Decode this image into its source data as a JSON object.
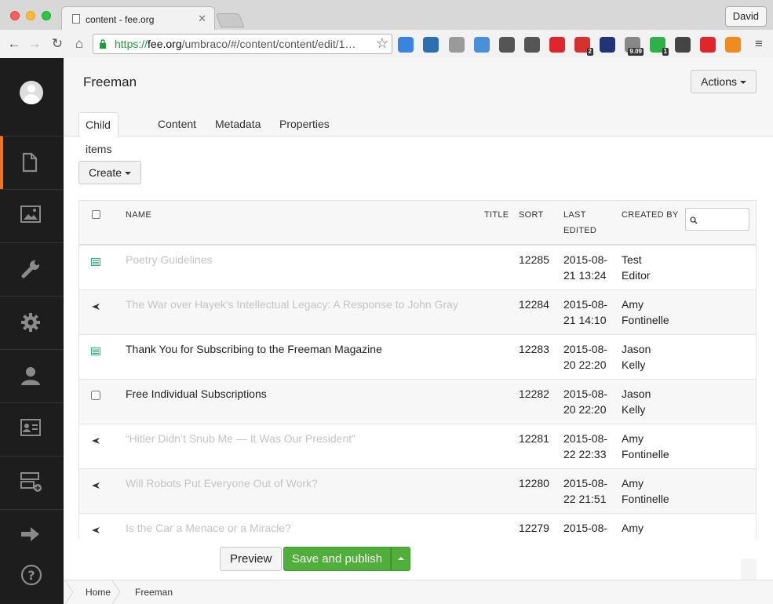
{
  "browser": {
    "tab_title": "content - fee.org",
    "profile_name": "David",
    "url_scheme": "https://",
    "url_host": "fee.org",
    "url_rest": "/umbraco/#/content/content/edit/1…",
    "extensions": [
      {
        "icon": "translate-icon",
        "color": "#3b82e5",
        "badge": ""
      },
      {
        "icon": "network-icon",
        "color": "#2c6fb2",
        "badge": ""
      },
      {
        "icon": "circle-icon",
        "color": "#9a9a9a",
        "badge": ""
      },
      {
        "icon": "folder-icon",
        "color": "#4a90d9",
        "badge": ""
      },
      {
        "icon": "plug-icon",
        "color": "#555555",
        "badge": ""
      },
      {
        "icon": "evernote-icon",
        "color": "#555555",
        "badge": ""
      },
      {
        "icon": "adblock-icon",
        "color": "#e0262c",
        "badge": ""
      },
      {
        "icon": "snowflake-icon",
        "color": "#d8302e",
        "badge": "2"
      },
      {
        "icon": "flag-icon",
        "color": "#23337a",
        "badge": ""
      },
      {
        "icon": "speed-icon",
        "color": "#888888",
        "badge": "9.09"
      },
      {
        "icon": "d-icon",
        "color": "#2db14b",
        "badge": "1"
      },
      {
        "icon": "gear-icon",
        "color": "#444444",
        "badge": ""
      },
      {
        "icon": "plus-cross-icon",
        "color": "#e0262c",
        "badge": ""
      },
      {
        "icon": "u-icon",
        "color": "#f28b1f",
        "badge": ""
      }
    ]
  },
  "header": {
    "title": "Freeman",
    "actions_label": "Actions",
    "tabs": [
      {
        "label": "Child items",
        "active": true
      },
      {
        "label": "Content",
        "active": false
      },
      {
        "label": "Metadata",
        "active": false
      },
      {
        "label": "Properties",
        "active": false
      }
    ]
  },
  "create_label": "Create",
  "table": {
    "columns": {
      "name": "NAME",
      "title": "TITLE",
      "sort": "SORT",
      "last_edited_1": "LAST",
      "last_edited_2": "EDITED",
      "created_by": "CREATED BY"
    },
    "rows": [
      {
        "icon": "newspaper-icon",
        "name": "Poetry Guidelines",
        "published": false,
        "sort": "12285",
        "edited_1": "2015-08-",
        "edited_2": "21 13:24",
        "by_1": "Test",
        "by_2": "Editor"
      },
      {
        "icon": "plane-icon",
        "name": "The War over Hayek's Intellectual Legacy: A Response to John Gray",
        "published": false,
        "sort": "12284",
        "edited_1": "2015-08-",
        "edited_2": "21 14:10",
        "by_1": "Amy",
        "by_2": "Fontinelle"
      },
      {
        "icon": "newspaper-icon",
        "name": "Thank You for Subscribing to the Freeman Magazine",
        "published": true,
        "sort": "12283",
        "edited_1": "2015-08-",
        "edited_2": "20 22:20",
        "by_1": "Jason",
        "by_2": "Kelly"
      },
      {
        "icon": "checkbox-icon",
        "name": "Free Individual Subscriptions",
        "published": true,
        "sort": "12282",
        "edited_1": "2015-08-",
        "edited_2": "20 22:20",
        "by_1": "Jason",
        "by_2": "Kelly"
      },
      {
        "icon": "plane-icon",
        "name": "“Hitler Didn’t Snub Me — It Was Our President”",
        "published": false,
        "sort": "12281",
        "edited_1": "2015-08-",
        "edited_2": "22 22:33",
        "by_1": "Amy",
        "by_2": "Fontinelle"
      },
      {
        "icon": "plane-icon",
        "name": "Will Robots Put Everyone Out of Work?",
        "published": false,
        "sort": "12280",
        "edited_1": "2015-08-",
        "edited_2": "22 21:51",
        "by_1": "Amy",
        "by_2": "Fontinelle"
      },
      {
        "icon": "plane-icon",
        "name": "Is the Car a Menace or a Miracle?",
        "published": false,
        "sort": "12279",
        "edited_1": "2015-08-",
        "edited_2": "",
        "by_1": "Amy",
        "by_2": ""
      }
    ]
  },
  "buttons": {
    "preview": "Preview",
    "save_publish": "Save and publish"
  },
  "breadcrumb": [
    "Home",
    "Freeman"
  ],
  "colors": {
    "accent": "#f5721b",
    "publish_green": "#50ae3a",
    "sidebar": "#1d1d1d"
  }
}
